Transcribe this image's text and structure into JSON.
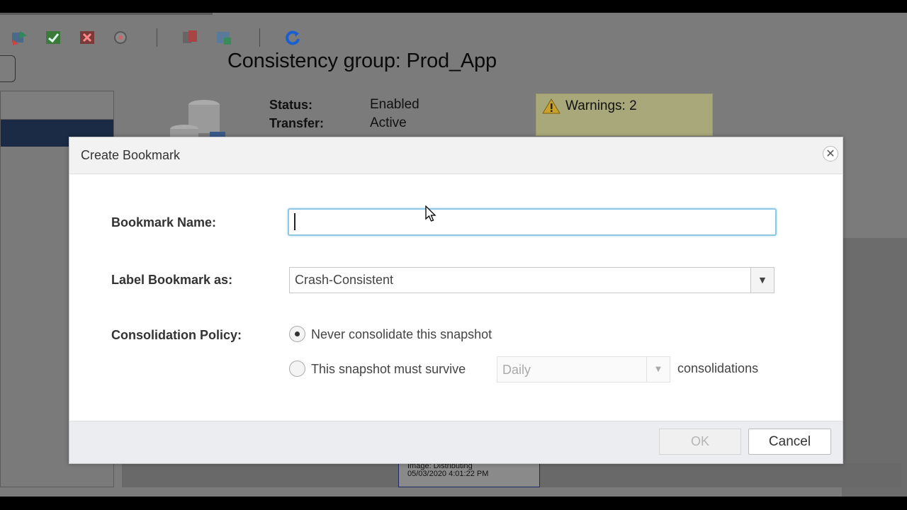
{
  "background": {
    "page_title": "Consistency group: Prod_App",
    "status_label": "Status:",
    "status_value": "Enabled",
    "transfer_label": "Transfer:",
    "transfer_value": "Active",
    "warnings_label": "Warnings: 2",
    "image_label_line1": "Image: Distributing",
    "image_label_line2": "05/03/2020 4:01:22 PM",
    "toolbar_icons": [
      "transfer-icon",
      "enable-icon",
      "disable-icon",
      "settings-icon",
      "copy-icon",
      "replicate-icon",
      "refresh-icon"
    ]
  },
  "dialog": {
    "title": "Create Bookmark",
    "bookmark_name_label": "Bookmark Name:",
    "bookmark_name_value": "",
    "label_bookmark_as_label": "Label Bookmark as:",
    "label_bookmark_as_value": "Crash-Consistent",
    "consolidation_policy_label": "Consolidation Policy:",
    "option_never": "Never consolidate this snapshot",
    "option_survive": "This snapshot must survive",
    "survive_select_value": "Daily",
    "consolidations_suffix": "consolidations",
    "selected_option": "never",
    "ok_label": "OK",
    "cancel_label": "Cancel"
  },
  "colors": {
    "accent_focus": "#8fc7e6",
    "warning_bg": "#a9a87a",
    "selected_nav": "#1b2a45"
  }
}
